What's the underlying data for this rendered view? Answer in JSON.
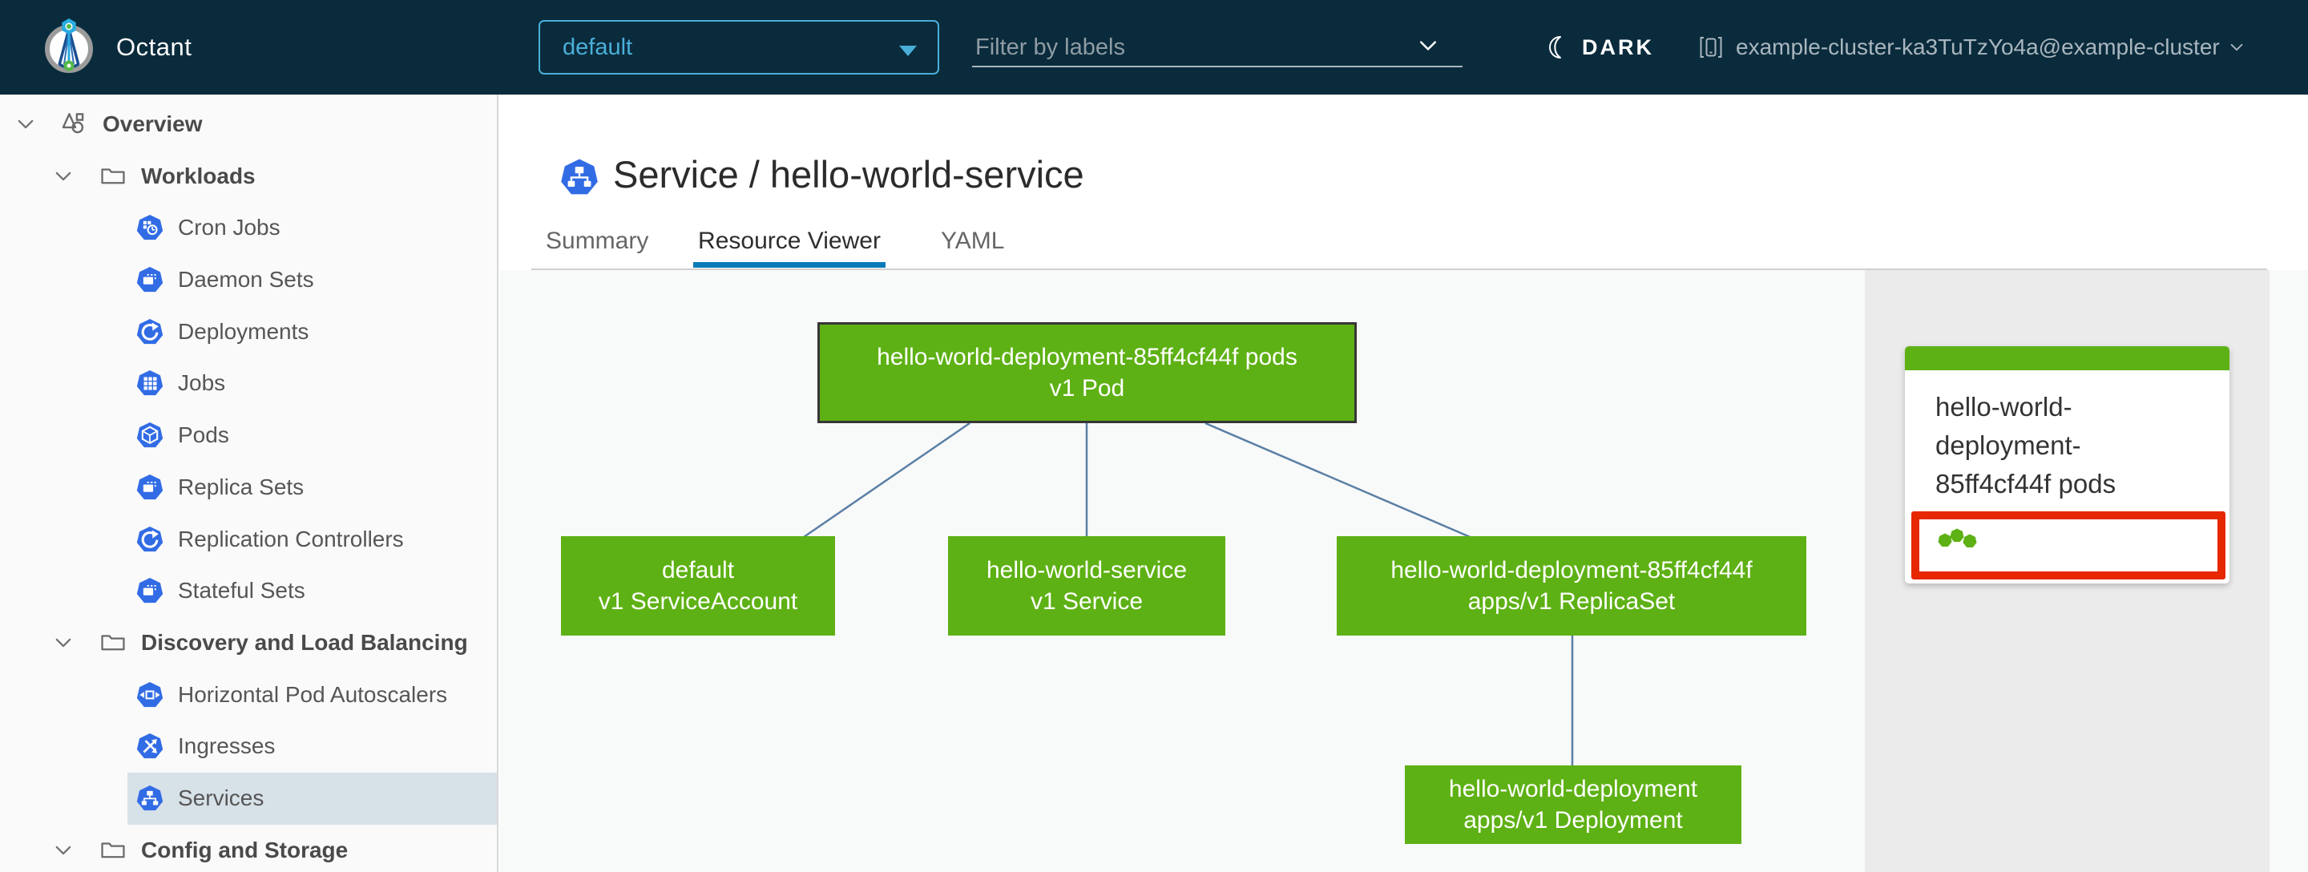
{
  "header": {
    "app_title": "Octant",
    "namespace_dropdown": {
      "value": "default"
    },
    "filter_input": {
      "placeholder": "Filter by labels"
    },
    "theme_toggle": {
      "label": "DARK"
    },
    "context_switcher": {
      "label": "example-cluster-ka3TuTzYo4a@example-cluster"
    }
  },
  "sidebar": {
    "items": [
      {
        "label": "Overview",
        "level": 0,
        "expanded": true,
        "selected": false
      },
      {
        "label": "Workloads",
        "level": 1,
        "expanded": true,
        "selected": false
      },
      {
        "label": "Cron Jobs",
        "level": 2,
        "selected": false
      },
      {
        "label": "Daemon Sets",
        "level": 2,
        "selected": false
      },
      {
        "label": "Deployments",
        "level": 2,
        "selected": false
      },
      {
        "label": "Jobs",
        "level": 2,
        "selected": false
      },
      {
        "label": "Pods",
        "level": 2,
        "selected": false
      },
      {
        "label": "Replica Sets",
        "level": 2,
        "selected": false
      },
      {
        "label": "Replication Controllers",
        "level": 2,
        "selected": false
      },
      {
        "label": "Stateful Sets",
        "level": 2,
        "selected": false
      },
      {
        "label": "Discovery and Load Balancing",
        "level": 1,
        "expanded": true,
        "selected": false
      },
      {
        "label": "Horizontal Pod Autoscalers",
        "level": 2,
        "selected": false
      },
      {
        "label": "Ingresses",
        "level": 2,
        "selected": false
      },
      {
        "label": "Services",
        "level": 2,
        "selected": true
      },
      {
        "label": "Config and Storage",
        "level": 1,
        "expanded": true,
        "selected": false
      }
    ]
  },
  "main": {
    "page_title": "Service / hello-world-service",
    "tabs": [
      {
        "label": "Summary",
        "active": false
      },
      {
        "label": "Resource Viewer",
        "active": true
      },
      {
        "label": "YAML",
        "active": false
      }
    ]
  },
  "graph": {
    "nodes": {
      "pod": {
        "line1": "hello-world-deployment-85ff4cf44f pods",
        "line2": "v1 Pod",
        "selected": true
      },
      "serviceaccount": {
        "line1": "default",
        "line2": "v1 ServiceAccount"
      },
      "service": {
        "line1": "hello-world-service",
        "line2": "v1 Service"
      },
      "replicaset": {
        "line1": "hello-world-deployment-85ff4cf44f",
        "line2": "apps/v1 ReplicaSet"
      },
      "deployment": {
        "line1": "hello-world-deployment",
        "line2": "apps/v1 Deployment"
      }
    }
  },
  "side_panel": {
    "card": {
      "title": "hello-world-deployment-85ff4cf44f pods",
      "pod_status": {
        "count": 3,
        "highlighted": true
      }
    }
  },
  "colors": {
    "header_background": "#0a2b3c",
    "accent_blue": "#49afd9",
    "tab_active_underline": "#0a7ab8",
    "node_green": "#5eb114",
    "kubernetes_icon_blue": "#326ce5",
    "selection_red": "#e62700",
    "edge_blue": "#5a7fa5",
    "sidebar_selected_background": "#d7e1e8"
  }
}
